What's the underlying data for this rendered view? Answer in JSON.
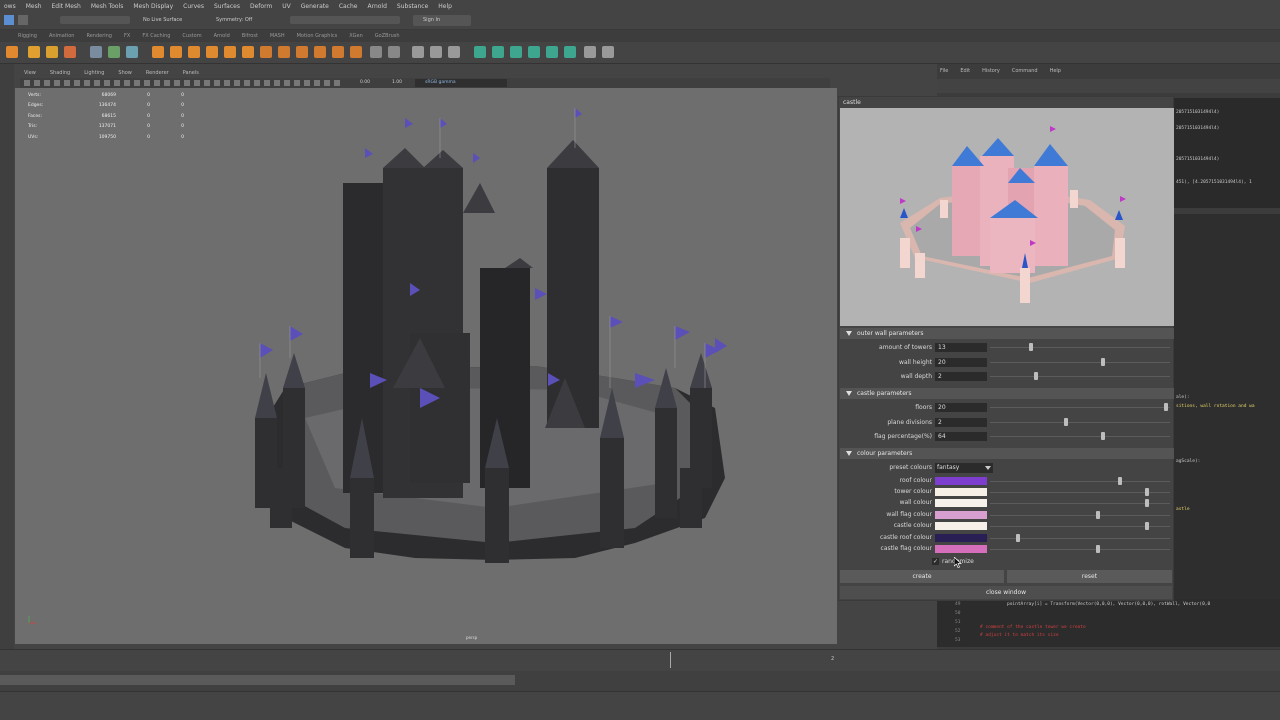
{
  "main_menu": [
    "ows",
    "Mesh",
    "Edit Mesh",
    "Mesh Tools",
    "Mesh Display",
    "Curves",
    "Surfaces",
    "Deform",
    "UV",
    "Generate",
    "Cache",
    "Arnold",
    "Substance",
    "Help"
  ],
  "status_line": {
    "live_surface": "No Live Surface",
    "symmetry": "Symmetry: Off",
    "sign_in": "Sign In"
  },
  "shelf_tabs": [
    "Rigging",
    "Animation",
    "Rendering",
    "FX",
    "FX Caching",
    "Custom",
    "Arnold",
    "Bifrost",
    "MASH",
    "Motion Graphics",
    "XGen",
    "GoZBrush"
  ],
  "viewport": {
    "menu": [
      "View",
      "Shading",
      "Lighting",
      "Show",
      "Renderer",
      "Panels"
    ],
    "toolbar": {
      "value1": "0.00",
      "value2": "1.00",
      "colorspace": "sRGB gamma"
    },
    "hud": [
      {
        "label": "Verts:",
        "value": "68069",
        "a": "0",
        "b": "0"
      },
      {
        "label": "Edges:",
        "value": "136474",
        "a": "0",
        "b": "0"
      },
      {
        "label": "Faces:",
        "value": "68615",
        "a": "0",
        "b": "0"
      },
      {
        "label": "Tris:",
        "value": "137071",
        "a": "0",
        "b": "0"
      },
      {
        "label": "UVs:",
        "value": "109750",
        "a": "0",
        "b": "0"
      }
    ],
    "camera": "persp",
    "colors": {
      "background": "#6e6e6e",
      "castle": "#2e2e30",
      "flag": "#5b4fb8",
      "roof": "#3f4048"
    }
  },
  "script_editor": {
    "menu": [
      "File",
      "Edit",
      "History",
      "Command",
      "Help"
    ],
    "history": [
      "2057151031494l4)",
      "2057151031494l4)",
      "2057151031494l4)",
      "451), [4.2057151031494l4), 1",
      "ale):",
      "sitions, wall rotation and wa",
      "agScale):",
      "astle"
    ],
    "code": [
      "pointArray[i] = Transform(Vector(0,0,0), Vector(0,0,0), rotWall, Vector(0,0",
      "# comment of the castle tower we create",
      "# adjust it to match its size"
    ],
    "line_numbers": [
      "49",
      "50",
      "51",
      "52",
      "53"
    ]
  },
  "tool": {
    "title": "castle",
    "preview_colors": {
      "background": "#b3b3b3",
      "wall": "#f1cfc6",
      "tower": "#e7a9b6",
      "roof": "#3f7ad6",
      "flag": "#c038c8"
    },
    "outer_wall": {
      "title": "outer wall parameters",
      "rows": [
        {
          "label": "amount of towers",
          "value": "13",
          "slider": 0.22
        },
        {
          "label": "wall height",
          "value": "20",
          "slider": 0.63
        },
        {
          "label": "wall depth",
          "value": "2",
          "slider": 0.25
        }
      ]
    },
    "castle": {
      "title": "castle parameters",
      "rows": [
        {
          "label": "floors",
          "value": "20",
          "slider": 0.99
        },
        {
          "label": "plane divisions",
          "value": "2",
          "slider": 0.42
        },
        {
          "label": "flag percentage(%)",
          "value": "64",
          "slider": 0.63
        }
      ]
    },
    "colour": {
      "title": "colour parameters",
      "preset_label": "preset colours",
      "preset_value": "fantasy",
      "rows": [
        {
          "label": "roof colour",
          "color": "#7d3ed0",
          "slider": 0.73
        },
        {
          "label": "tower colour",
          "color": "#f5efe6",
          "slider": 0.88
        },
        {
          "label": "wall colour",
          "color": "#f6f1ea",
          "slider": 0.88
        },
        {
          "label": "wall flag colour",
          "color": "#d79ed0",
          "slider": 0.6
        },
        {
          "label": "castle colour",
          "color": "#f6f0e8",
          "slider": 0.88
        },
        {
          "label": "castle roof colour",
          "color": "#2a1f55",
          "slider": 0.15
        },
        {
          "label": "castle flag colour",
          "color": "#d56fbc",
          "slider": 0.6
        }
      ],
      "randomize_label": "randomize",
      "randomize_checked": true
    },
    "buttons": {
      "create": "create",
      "reset": "reset",
      "close": "close window"
    }
  },
  "timeline": {
    "current_frame": "2"
  }
}
